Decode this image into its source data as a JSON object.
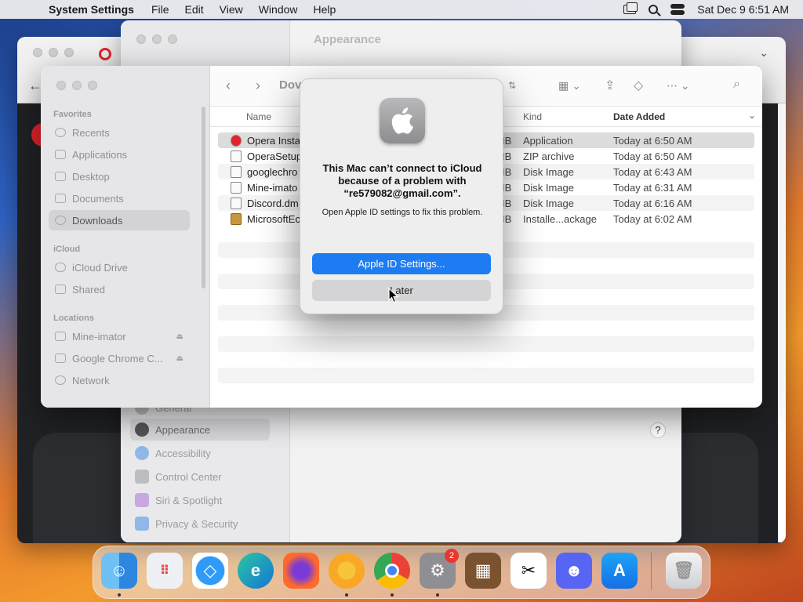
{
  "menubar": {
    "app_name": "System Settings",
    "menus": [
      "File",
      "Edit",
      "View",
      "Window",
      "Help"
    ],
    "clock": "Sat Dec 9  6:51 AM"
  },
  "settings_window": {
    "title": "Appearance",
    "items": [
      {
        "label": "General"
      },
      {
        "label": "Appearance"
      },
      {
        "label": "Accessibility"
      },
      {
        "label": "Control Center"
      },
      {
        "label": "Siri & Spotlight"
      },
      {
        "label": "Privacy & Security"
      }
    ],
    "help": "?"
  },
  "finder": {
    "title": "Dov",
    "sidebar": {
      "favorites_label": "Favorites",
      "favorites": [
        "Recents",
        "Applications",
        "Desktop",
        "Documents",
        "Downloads"
      ],
      "icloud_label": "iCloud",
      "icloud": [
        "iCloud Drive",
        "Shared"
      ],
      "locations_label": "Locations",
      "locations": [
        "Mine-imator",
        "Google Chrome C...",
        "Network"
      ]
    },
    "columns": {
      "name": "Name",
      "kind": "Kind",
      "date_added": "Date Added"
    },
    "files": [
      {
        "name": "Opera Insta",
        "size": "IB",
        "kind": "Application",
        "date": "Today at 6:50 AM"
      },
      {
        "name": "OperaSetup",
        "size": "IB",
        "kind": "ZIP archive",
        "date": "Today at 6:50 AM"
      },
      {
        "name": "googlechro",
        "size": "IB",
        "kind": "Disk Image",
        "date": "Today at 6:43 AM"
      },
      {
        "name": "Mine-imato",
        "size": "IB",
        "kind": "Disk Image",
        "date": "Today at 6:31 AM"
      },
      {
        "name": "Discord.dm",
        "size": "IB",
        "kind": "Disk Image",
        "date": "Today at 6:16 AM"
      },
      {
        "name": "MicrosoftEc",
        "size": "IB",
        "kind": "Installe...ackage",
        "date": "Today at 6:02 AM"
      }
    ]
  },
  "dialog": {
    "title": "This Mac can’t connect to iCloud because of a problem with “re579082@gmail.com”.",
    "message": "Open Apple ID settings to fix this problem.",
    "primary_button": "Apple ID Settings...",
    "secondary_button": "Later"
  },
  "dock": {
    "items": [
      "Finder",
      "Launchpad",
      "Safari",
      "Edge",
      "Firefox",
      "Chrome Canary",
      "Chrome",
      "System Settings",
      "Minecraft",
      "CapCut",
      "Discord",
      "App Store",
      "Trash"
    ],
    "settings_badge": "2"
  },
  "colors": {
    "accent": "#1e7cf2"
  }
}
